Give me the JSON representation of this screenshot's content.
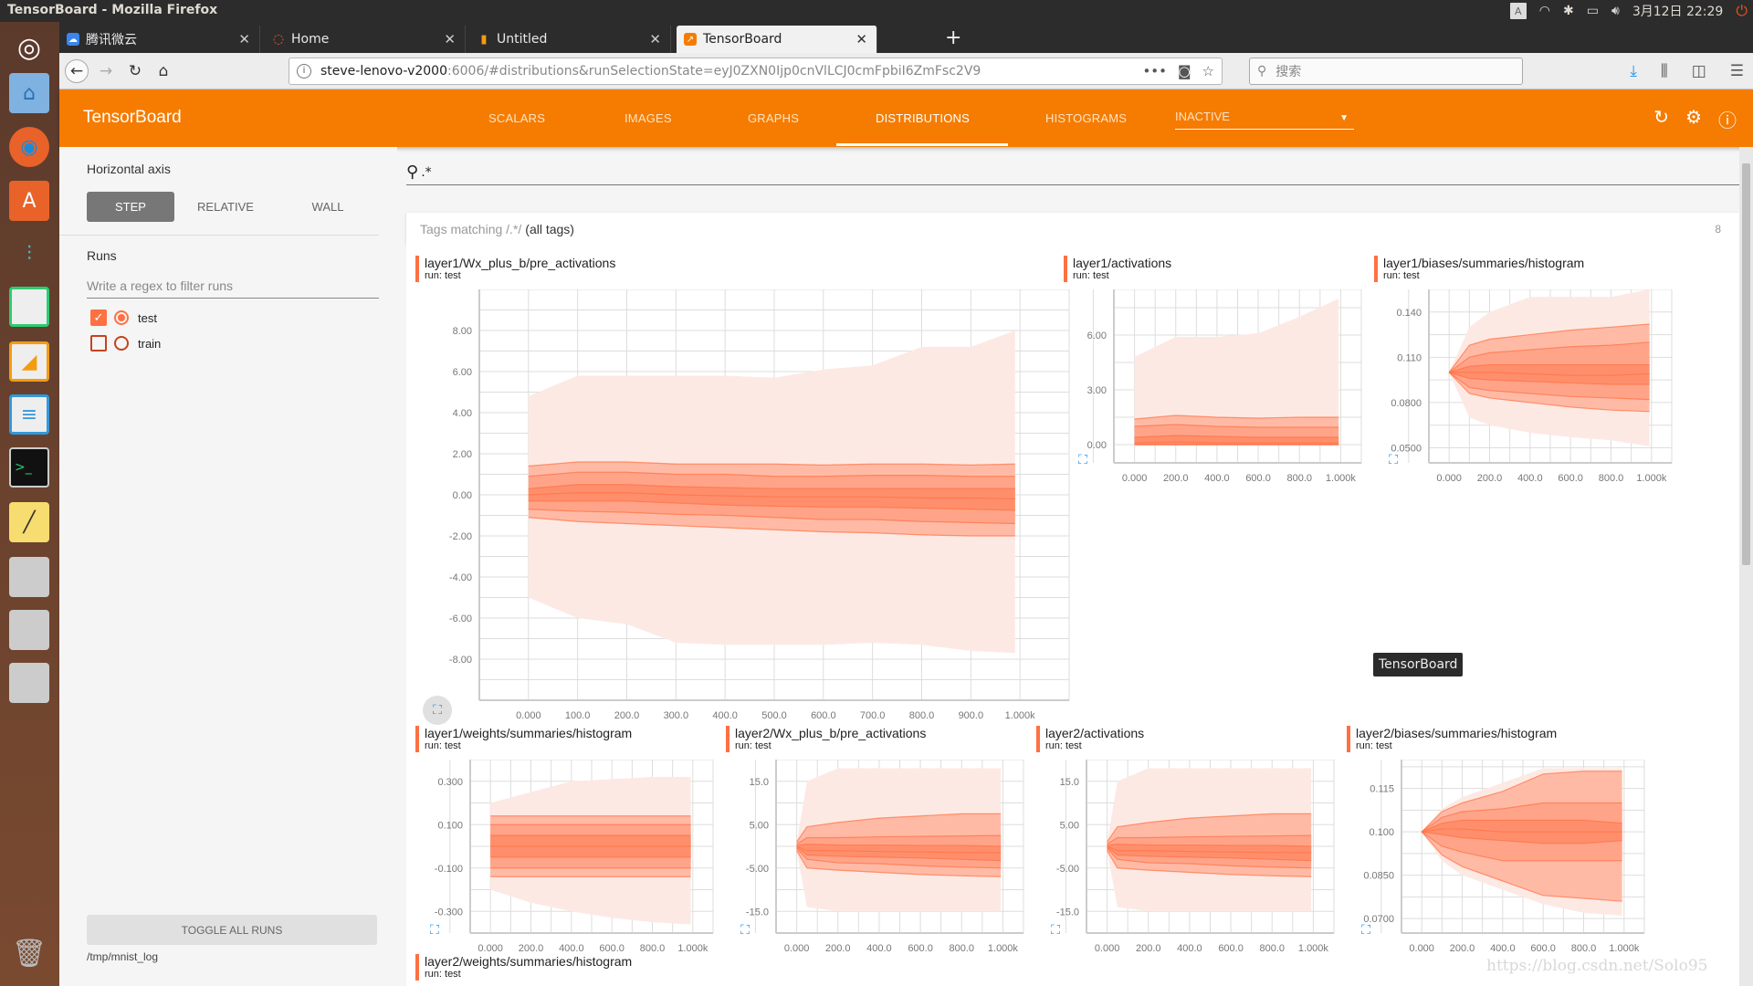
{
  "os": {
    "window_title": "TensorBoard - Mozilla Firefox",
    "tray": {
      "keyboard": "A",
      "datetime": "3月12日 22:29"
    }
  },
  "browser": {
    "tabs": [
      {
        "label": "腾讯微云",
        "icon": "weiyun-cloud-icon"
      },
      {
        "label": "Home",
        "icon": "loading-spinner-icon"
      },
      {
        "label": "Untitled",
        "icon": "notebook-icon"
      },
      {
        "label": "TensorBoard",
        "icon": "tensorboard-icon",
        "active": true
      }
    ],
    "url_host": "steve-lenovo-v2000",
    "url_rest": ":6006/#distributions&runSelectionState=eyJ0ZXN0Ijp0cnVlLCJ0cmFpbiI6ZmFsc2V9",
    "search_placeholder": "搜索"
  },
  "tensorboard": {
    "brand": "TensorBoard",
    "tabs": [
      "SCALARS",
      "IMAGES",
      "GRAPHS",
      "DISTRIBUTIONS",
      "HISTOGRAMS"
    ],
    "active_tab": "DISTRIBUTIONS",
    "inactive_select": "INACTIVE",
    "accent": "#f57c00",
    "series_color": "#ff7043"
  },
  "sidebar": {
    "horizontal_axis_label": "Horizontal axis",
    "axis_options": [
      "STEP",
      "RELATIVE",
      "WALL"
    ],
    "axis_selected": "STEP",
    "runs_label": "Runs",
    "regex_placeholder": "Write a regex to filter runs",
    "runs": [
      {
        "name": "test",
        "checked": true
      },
      {
        "name": "train",
        "checked": false
      }
    ],
    "toggle_all": "TOGGLE ALL RUNS",
    "logdir": "/tmp/mnist_log"
  },
  "main": {
    "filter_value": ".*",
    "tags_prefix": "Tags matching /.*/",
    "tags_all": "(all tags)",
    "tags_count": "8",
    "tooltip": "TensorBoard"
  },
  "watermark": "https://blog.csdn.net/Solo95",
  "chart_data": [
    {
      "type": "area",
      "title": "layer1/Wx_plus_b/pre_activations",
      "run": "run: test",
      "xticks": [
        "0.000",
        "100.0",
        "200.0",
        "300.0",
        "400.0",
        "500.0",
        "600.0",
        "700.0",
        "800.0",
        "900.0",
        "1.000k"
      ],
      "yticks": [
        "8.00",
        "6.00",
        "4.00",
        "2.00",
        "0.00",
        "-2.00",
        "-4.00",
        "-6.00",
        "-8.00"
      ],
      "ylim": [
        -10,
        10
      ],
      "xlim": [
        -100,
        1100
      ],
      "x": [
        0,
        100,
        200,
        300,
        400,
        500,
        600,
        700,
        800,
        900,
        990
      ],
      "bands": {
        "max": [
          4.8,
          5.8,
          5.8,
          5.8,
          5.8,
          5.7,
          6.1,
          6.3,
          7.2,
          7.2,
          8.0
        ],
        "p93": [
          1.4,
          1.6,
          1.6,
          1.5,
          1.5,
          1.5,
          1.45,
          1.5,
          1.5,
          1.45,
          1.5
        ],
        "p84": [
          0.9,
          1.1,
          1.1,
          1.0,
          1.0,
          0.9,
          0.9,
          0.95,
          0.95,
          0.9,
          0.9
        ],
        "p69": [
          0.3,
          0.5,
          0.5,
          0.4,
          0.35,
          0.3,
          0.3,
          0.3,
          0.3,
          0.3,
          0.3
        ],
        "p50": [
          0.0,
          0.1,
          0.1,
          0.0,
          -0.05,
          -0.1,
          -0.1,
          -0.1,
          -0.15,
          -0.15,
          -0.2
        ],
        "p31": [
          -0.3,
          -0.3,
          -0.3,
          -0.4,
          -0.5,
          -0.55,
          -0.6,
          -0.6,
          -0.65,
          -0.7,
          -0.75
        ],
        "p16": [
          -0.7,
          -0.8,
          -0.85,
          -0.95,
          -1.0,
          -1.1,
          -1.2,
          -1.2,
          -1.3,
          -1.35,
          -1.4
        ],
        "p7": [
          -1.1,
          -1.3,
          -1.4,
          -1.5,
          -1.6,
          -1.7,
          -1.8,
          -1.85,
          -1.95,
          -2.0,
          -2.0
        ],
        "min": [
          -5.0,
          -6.0,
          -6.3,
          -7.2,
          -7.3,
          -7.3,
          -7.3,
          -7.2,
          -7.3,
          -7.6,
          -7.7
        ]
      }
    },
    {
      "type": "area",
      "title": "layer1/activations",
      "run": "run: test",
      "xticks": [
        "0.000",
        "200.0",
        "400.0",
        "600.0",
        "800.0",
        "1.000k"
      ],
      "yticks": [
        "6.00",
        "3.00",
        "0.00"
      ],
      "ylim": [
        -1,
        8.5
      ],
      "xlim": [
        -100,
        1100
      ],
      "x": [
        0,
        200,
        400,
        600,
        800,
        990
      ],
      "bands": {
        "max": [
          4.8,
          5.9,
          5.9,
          6.1,
          7.0,
          8.0
        ],
        "p93": [
          1.4,
          1.6,
          1.5,
          1.45,
          1.5,
          1.5
        ],
        "p84": [
          1.0,
          1.1,
          1.0,
          0.95,
          0.95,
          0.95
        ],
        "p69": [
          0.4,
          0.5,
          0.45,
          0.4,
          0.4,
          0.4
        ],
        "p50": [
          0.1,
          0.15,
          0.1,
          0.1,
          0.1,
          0.1
        ],
        "p31": [
          0,
          0,
          0,
          0,
          0,
          0
        ],
        "p16": [
          0,
          0,
          0,
          0,
          0,
          0
        ],
        "p7": [
          0,
          0,
          0,
          0,
          0,
          0
        ],
        "min": [
          0,
          0,
          0,
          0,
          0,
          0
        ]
      }
    },
    {
      "type": "area",
      "title": "layer1/biases/summaries/histogram",
      "run": "run: test",
      "xticks": [
        "0.000",
        "200.0",
        "400.0",
        "600.0",
        "800.0",
        "1.000k"
      ],
      "yticks": [
        "0.140",
        "0.110",
        "0.0800",
        "0.0500"
      ],
      "ylim": [
        0.04,
        0.155
      ],
      "xlim": [
        -100,
        1100
      ],
      "x": [
        0,
        100,
        200,
        400,
        600,
        800,
        990
      ],
      "bands": {
        "max": [
          0.1,
          0.13,
          0.14,
          0.15,
          0.15,
          0.15,
          0.155
        ],
        "p93": [
          0.1,
          0.118,
          0.122,
          0.125,
          0.128,
          0.13,
          0.132
        ],
        "p84": [
          0.1,
          0.11,
          0.113,
          0.115,
          0.117,
          0.118,
          0.12
        ],
        "p69": [
          0.1,
          0.104,
          0.105,
          0.105,
          0.105,
          0.105,
          0.105
        ],
        "p50": [
          0.1,
          0.1,
          0.1,
          0.099,
          0.098,
          0.098,
          0.099
        ],
        "p31": [
          0.1,
          0.096,
          0.095,
          0.094,
          0.093,
          0.092,
          0.092
        ],
        "p16": [
          0.1,
          0.09,
          0.088,
          0.086,
          0.084,
          0.083,
          0.082
        ],
        "p7": [
          0.1,
          0.086,
          0.083,
          0.08,
          0.077,
          0.075,
          0.074
        ],
        "min": [
          0.1,
          0.07,
          0.065,
          0.06,
          0.057,
          0.055,
          0.051
        ]
      }
    },
    {
      "type": "area",
      "title": "layer1/weights/summaries/histogram",
      "run": "run: test",
      "xticks": [
        "0.000",
        "200.0",
        "400.0",
        "600.0",
        "800.0",
        "1.000k"
      ],
      "yticks": [
        "0.300",
        "0.100",
        "-0.100",
        "-0.300"
      ],
      "ylim": [
        -0.4,
        0.4
      ],
      "xlim": [
        -100,
        1100
      ],
      "x": [
        0,
        200,
        400,
        600,
        800,
        990
      ],
      "bands": {
        "max": [
          0.2,
          0.25,
          0.3,
          0.31,
          0.32,
          0.32
        ],
        "p93": [
          0.14,
          0.14,
          0.14,
          0.14,
          0.14,
          0.14
        ],
        "p84": [
          0.1,
          0.1,
          0.1,
          0.1,
          0.1,
          0.1
        ],
        "p69": [
          0.05,
          0.05,
          0.05,
          0.05,
          0.05,
          0.05
        ],
        "p50": [
          0,
          0,
          0,
          0,
          0,
          0
        ],
        "p31": [
          -0.05,
          -0.05,
          -0.05,
          -0.05,
          -0.05,
          -0.05
        ],
        "p16": [
          -0.1,
          -0.1,
          -0.1,
          -0.1,
          -0.1,
          -0.1
        ],
        "p7": [
          -0.14,
          -0.14,
          -0.14,
          -0.14,
          -0.14,
          -0.14
        ],
        "min": [
          -0.2,
          -0.26,
          -0.3,
          -0.33,
          -0.35,
          -0.36
        ]
      }
    },
    {
      "type": "area",
      "title": "layer2/Wx_plus_b/pre_activations",
      "run": "run: test",
      "xticks": [
        "0.000",
        "200.0",
        "400.0",
        "600.0",
        "800.0",
        "1.000k"
      ],
      "yticks": [
        "15.0",
        "5.00",
        "-5.00",
        "-15.0"
      ],
      "ylim": [
        -20,
        20
      ],
      "xlim": [
        -100,
        1100
      ],
      "x": [
        0,
        50,
        200,
        400,
        600,
        800,
        990
      ],
      "bands": {
        "max": [
          1,
          15,
          18,
          18,
          18,
          18,
          18
        ],
        "p93": [
          1,
          4.5,
          5.5,
          6.5,
          7,
          7.5,
          7.5
        ],
        "p84": [
          0.5,
          2,
          2,
          2.2,
          2.3,
          2.4,
          2.5
        ],
        "p69": [
          0.2,
          0.5,
          0.3,
          0.3,
          0.2,
          0.2,
          0
        ],
        "p50": [
          0,
          -1,
          -1,
          -1.2,
          -1.3,
          -1.4,
          -1.5
        ],
        "p31": [
          -0.2,
          -2,
          -2.3,
          -2.5,
          -2.7,
          -3,
          -3.3
        ],
        "p16": [
          -0.5,
          -3,
          -3.8,
          -4,
          -4.5,
          -4.8,
          -5
        ],
        "p7": [
          -1,
          -5,
          -5.5,
          -6,
          -6.5,
          -6.8,
          -7
        ],
        "min": [
          -1,
          -14,
          -15,
          -15,
          -15,
          -15,
          -15
        ]
      }
    },
    {
      "type": "area",
      "title": "layer2/activations",
      "run": "run: test",
      "xticks": [
        "0.000",
        "200.0",
        "400.0",
        "600.0",
        "800.0",
        "1.000k"
      ],
      "yticks": [
        "15.0",
        "5.00",
        "-5.00",
        "-15.0"
      ],
      "ylim": [
        -20,
        20
      ],
      "xlim": [
        -100,
        1100
      ],
      "x": [
        0,
        50,
        200,
        400,
        600,
        800,
        990
      ],
      "bands": {
        "max": [
          1,
          15,
          18,
          18,
          18,
          18,
          18
        ],
        "p93": [
          1,
          4.5,
          5.5,
          6.5,
          7,
          7.5,
          7.5
        ],
        "p84": [
          0.5,
          2,
          2,
          2.2,
          2.3,
          2.4,
          2.5
        ],
        "p69": [
          0.2,
          0.5,
          0.3,
          0.3,
          0.2,
          0.2,
          0
        ],
        "p50": [
          0,
          -1,
          -1,
          -1.2,
          -1.3,
          -1.4,
          -1.5
        ],
        "p31": [
          -0.2,
          -2,
          -2.3,
          -2.5,
          -2.7,
          -3,
          -3.3
        ],
        "p16": [
          -0.5,
          -3,
          -3.8,
          -4,
          -4.5,
          -4.8,
          -5
        ],
        "p7": [
          -1,
          -5,
          -5.5,
          -6,
          -6.5,
          -6.8,
          -7
        ],
        "min": [
          -1,
          -14,
          -15,
          -15,
          -15,
          -15,
          -15
        ]
      }
    },
    {
      "type": "area",
      "title": "layer2/biases/summaries/histogram",
      "run": "run: test",
      "xticks": [
        "0.000",
        "200.0",
        "400.0",
        "600.0",
        "800.0",
        "1.000k"
      ],
      "yticks": [
        "0.115",
        "0.100",
        "0.0850",
        "0.0700"
      ],
      "ylim": [
        0.065,
        0.125
      ],
      "xlim": [
        -100,
        1100
      ],
      "x": [
        0,
        100,
        200,
        400,
        600,
        800,
        990
      ],
      "bands": {
        "max": [
          0.1,
          0.108,
          0.112,
          0.117,
          0.122,
          0.122,
          0.122
        ],
        "p93": [
          0.1,
          0.107,
          0.11,
          0.114,
          0.12,
          0.121,
          0.121
        ],
        "p84": [
          0.1,
          0.105,
          0.107,
          0.108,
          0.11,
          0.11,
          0.11
        ],
        "p69": [
          0.1,
          0.103,
          0.104,
          0.104,
          0.104,
          0.104,
          0.103
        ],
        "p50": [
          0.1,
          0.101,
          0.101,
          0.1,
          0.1,
          0.1,
          0.1
        ],
        "p31": [
          0.1,
          0.099,
          0.098,
          0.097,
          0.096,
          0.096,
          0.097
        ],
        "p16": [
          0.1,
          0.095,
          0.093,
          0.09,
          0.09,
          0.09,
          0.09
        ],
        "p7": [
          0.1,
          0.092,
          0.088,
          0.083,
          0.078,
          0.077,
          0.076
        ],
        "min": [
          0.1,
          0.09,
          0.085,
          0.08,
          0.075,
          0.072,
          0.071
        ]
      }
    },
    {
      "type": "area",
      "title": "layer2/weights/summaries/histogram",
      "run": "run: test"
    }
  ]
}
